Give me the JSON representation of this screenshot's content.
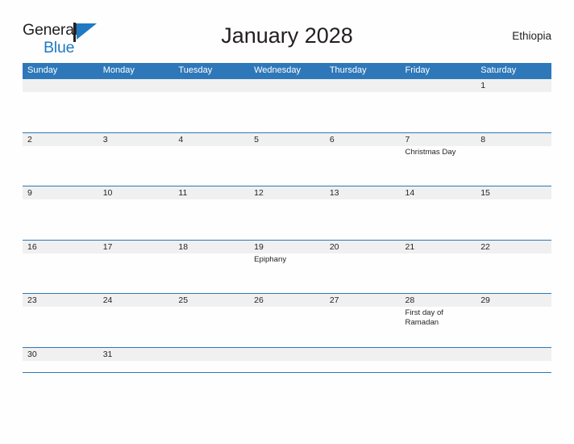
{
  "brand": {
    "name_top": "General",
    "name_bottom": "Blue",
    "flag_icon": "blue-triangle-flag-icon",
    "color_top": "#231f20",
    "color_bottom": "#1f7ac4"
  },
  "header": {
    "title": "January 2028",
    "country": "Ethiopia"
  },
  "theme": {
    "header_blue": "#2e78b9",
    "row_band_gray": "#f0f0f0",
    "text": "#231f20",
    "page_background": "#fefefe"
  },
  "calendar": {
    "weekdays": [
      "Sunday",
      "Monday",
      "Tuesday",
      "Wednesday",
      "Thursday",
      "Friday",
      "Saturday"
    ],
    "weeks": [
      [
        {
          "day": "",
          "event": ""
        },
        {
          "day": "",
          "event": ""
        },
        {
          "day": "",
          "event": ""
        },
        {
          "day": "",
          "event": ""
        },
        {
          "day": "",
          "event": ""
        },
        {
          "day": "",
          "event": ""
        },
        {
          "day": "1",
          "event": ""
        }
      ],
      [
        {
          "day": "2",
          "event": ""
        },
        {
          "day": "3",
          "event": ""
        },
        {
          "day": "4",
          "event": ""
        },
        {
          "day": "5",
          "event": ""
        },
        {
          "day": "6",
          "event": ""
        },
        {
          "day": "7",
          "event": "Christmas Day"
        },
        {
          "day": "8",
          "event": ""
        }
      ],
      [
        {
          "day": "9",
          "event": ""
        },
        {
          "day": "10",
          "event": ""
        },
        {
          "day": "11",
          "event": ""
        },
        {
          "day": "12",
          "event": ""
        },
        {
          "day": "13",
          "event": ""
        },
        {
          "day": "14",
          "event": ""
        },
        {
          "day": "15",
          "event": ""
        }
      ],
      [
        {
          "day": "16",
          "event": ""
        },
        {
          "day": "17",
          "event": ""
        },
        {
          "day": "18",
          "event": ""
        },
        {
          "day": "19",
          "event": "Epiphany"
        },
        {
          "day": "20",
          "event": ""
        },
        {
          "day": "21",
          "event": ""
        },
        {
          "day": "22",
          "event": ""
        }
      ],
      [
        {
          "day": "23",
          "event": ""
        },
        {
          "day": "24",
          "event": ""
        },
        {
          "day": "25",
          "event": ""
        },
        {
          "day": "26",
          "event": ""
        },
        {
          "day": "27",
          "event": ""
        },
        {
          "day": "28",
          "event": "First day of Ramadan"
        },
        {
          "day": "29",
          "event": ""
        }
      ],
      [
        {
          "day": "30",
          "event": ""
        },
        {
          "day": "31",
          "event": ""
        },
        {
          "day": "",
          "event": ""
        },
        {
          "day": "",
          "event": ""
        },
        {
          "day": "",
          "event": ""
        },
        {
          "day": "",
          "event": ""
        },
        {
          "day": "",
          "event": ""
        }
      ]
    ]
  }
}
